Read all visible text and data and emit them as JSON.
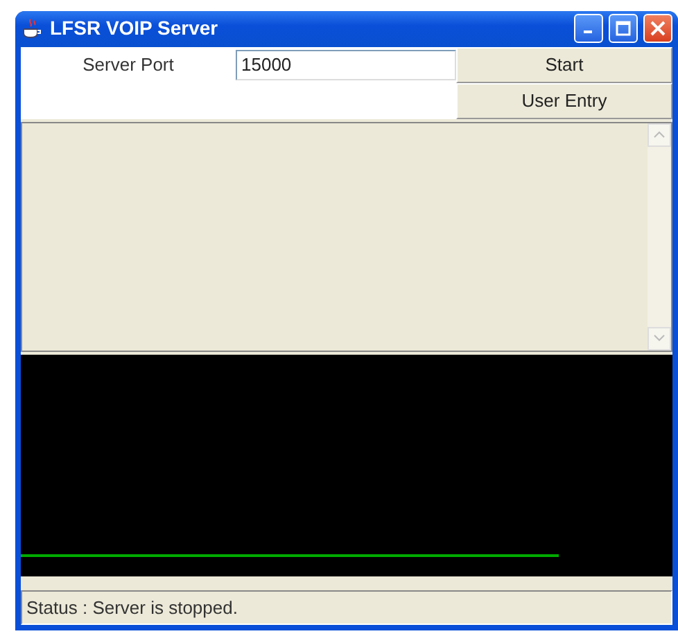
{
  "window": {
    "title": "LFSR VOIP Server"
  },
  "form": {
    "port_label": "Server Port",
    "port_value": "15000"
  },
  "buttons": [
    {
      "label": "Start"
    },
    {
      "label": "User Entry"
    }
  ],
  "status_bar": "Status : Server is stopped."
}
